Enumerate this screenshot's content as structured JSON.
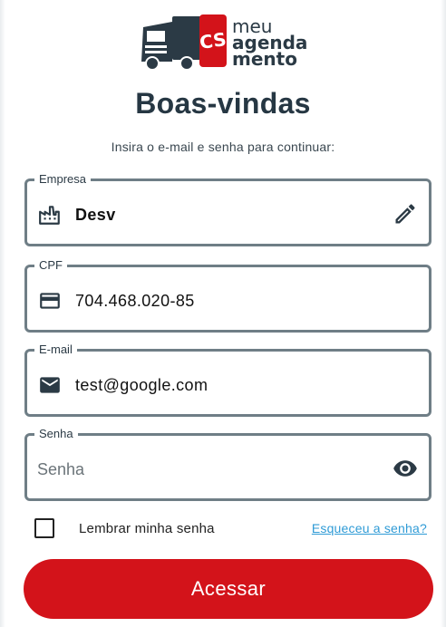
{
  "logo": {
    "line1": "meu",
    "line2": "agenda",
    "line3": "mento",
    "badge": "CS"
  },
  "title": "Boas-vindas",
  "subtitle": "Insira o e-mail e senha para continuar:",
  "fields": {
    "empresa": {
      "label": "Empresa",
      "value": "Desv",
      "icon": "factory-icon",
      "action": "edit-icon"
    },
    "cpf": {
      "label": "CPF",
      "value": "704.468.020-85",
      "icon": "credit-card-icon"
    },
    "email": {
      "label": "E-mail",
      "value": "test@google.com",
      "icon": "mail-icon"
    },
    "senha": {
      "label": "Senha",
      "placeholder": "Senha",
      "action": "eye-icon"
    }
  },
  "remember": {
    "label": "Lembrar minha senha",
    "checked": false
  },
  "forgot": "Esqueceu a senha?",
  "submit": "Acessar",
  "colors": {
    "brand_red": "#d3131a",
    "dark": "#263743",
    "link": "#2f9bd6",
    "border": "#6f7e86"
  }
}
